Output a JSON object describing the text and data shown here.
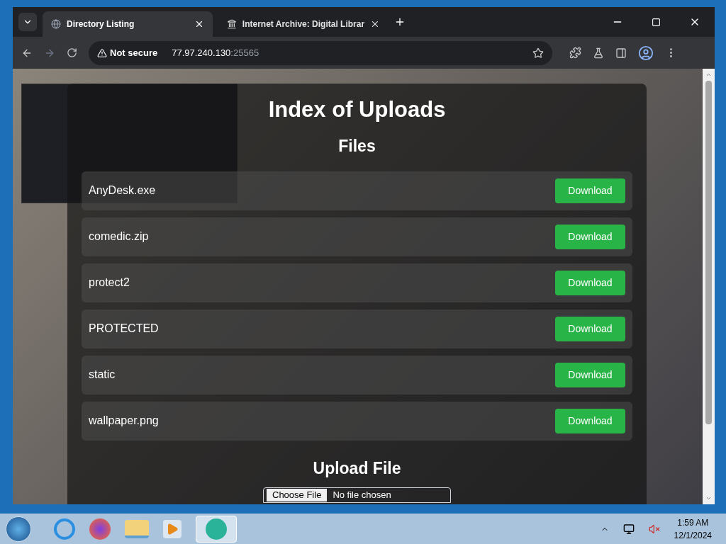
{
  "browser": {
    "tabs": [
      {
        "title": "Directory Listing",
        "selected": true
      },
      {
        "title": "Internet Archive: Digital Librar",
        "selected": false
      }
    ],
    "security_label": "Not secure",
    "url_host": "77.97.240.130",
    "url_port": ":25565"
  },
  "page": {
    "title": "Index of Uploads",
    "files_heading": "Files",
    "files": [
      {
        "name": "AnyDesk.exe",
        "action": "Download"
      },
      {
        "name": "comedic.zip",
        "action": "Download"
      },
      {
        "name": "protect2",
        "action": "Download"
      },
      {
        "name": "PROTECTED",
        "action": "Download"
      },
      {
        "name": "static",
        "action": "Download"
      },
      {
        "name": "wallpaper.png",
        "action": "Download"
      }
    ],
    "upload_heading": "Upload File",
    "file_input": {
      "button": "Choose File",
      "status": "No file chosen"
    }
  },
  "taskbar": {
    "time": "1:59 AM",
    "date": "12/1/2024"
  }
}
